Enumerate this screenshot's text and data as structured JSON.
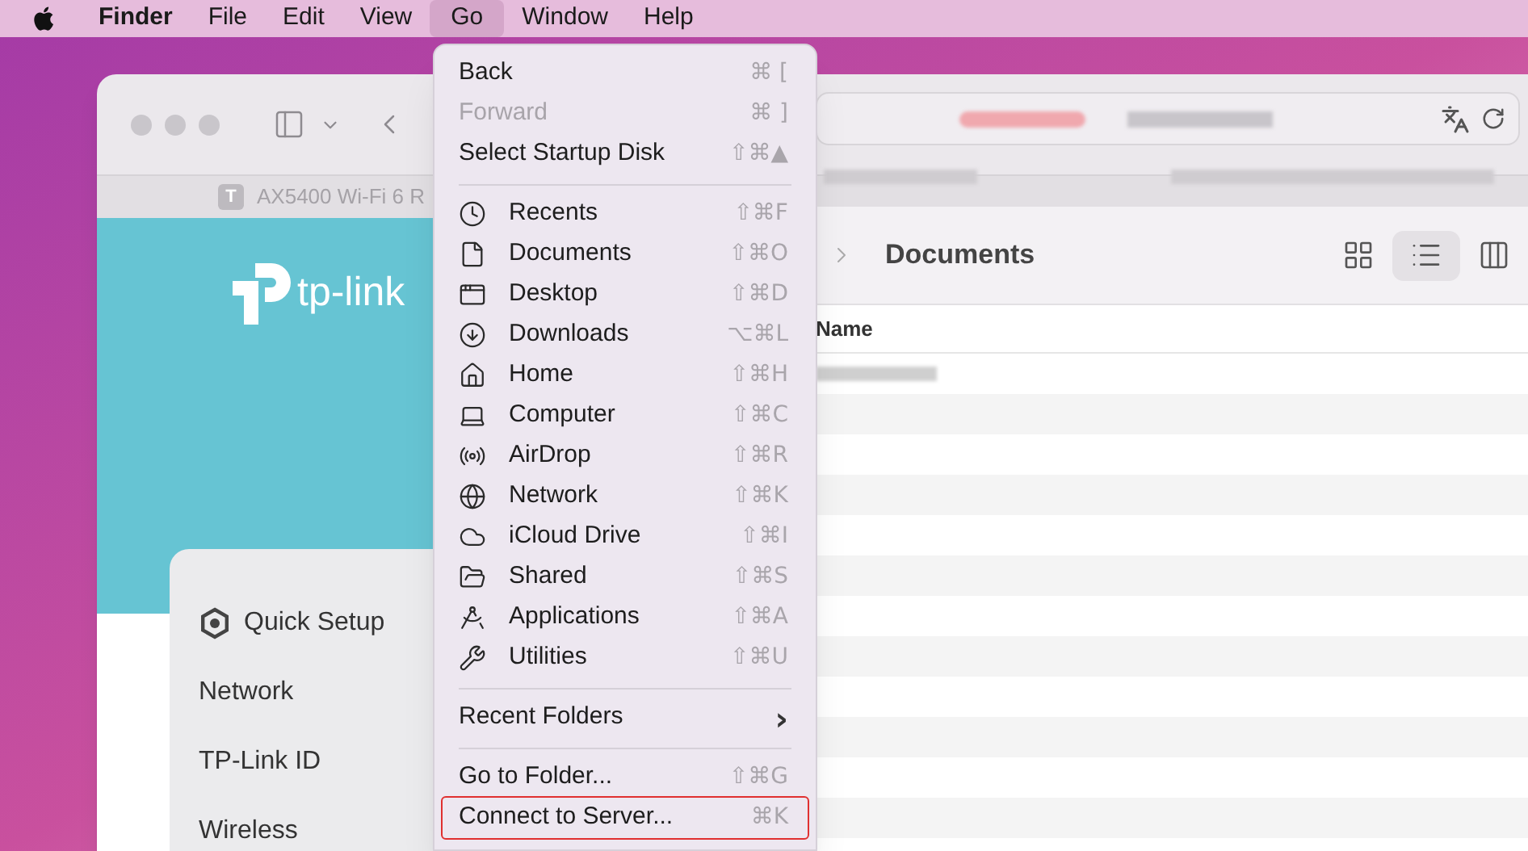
{
  "menu_bar": {
    "items": [
      {
        "label": "Finder",
        "selected": false
      },
      {
        "label": "File",
        "selected": false
      },
      {
        "label": "Edit",
        "selected": false
      },
      {
        "label": "View",
        "selected": false
      },
      {
        "label": "Go",
        "selected": true
      },
      {
        "label": "Window",
        "selected": false
      },
      {
        "label": "Help",
        "selected": false
      }
    ]
  },
  "browser": {
    "tab": {
      "favicon_letter": "T",
      "title": "AX5400 Wi-Fi 6 R"
    },
    "page": {
      "logo_text": "tp-link",
      "sidebar": [
        {
          "label": "Quick Setup",
          "kind": "gear"
        },
        {
          "label": "Network",
          "kind": "plain"
        },
        {
          "label": "TP-Link ID",
          "kind": "plain"
        },
        {
          "label": "Wireless",
          "kind": "plain"
        }
      ]
    }
  },
  "finder": {
    "title": "Documents",
    "views": [
      {
        "kind": "icons",
        "selected": false
      },
      {
        "kind": "list",
        "selected": true
      },
      {
        "kind": "columns",
        "selected": false
      }
    ],
    "columns": [
      "Name"
    ]
  },
  "go_menu": {
    "items": [
      {
        "kind": "command",
        "label": "Back",
        "shortcut": "⌘ [",
        "disabled": false,
        "outlined": false
      },
      {
        "kind": "command",
        "label": "Forward",
        "shortcut": "⌘ ]",
        "disabled": true,
        "outlined": false
      },
      {
        "kind": "command",
        "label": "Select Startup Disk",
        "shortcut": "⇧⌘▲",
        "disabled": false,
        "outlined": false
      },
      {
        "kind": "separator"
      },
      {
        "kind": "place",
        "label": "Recents",
        "shortcut": "⇧⌘F",
        "disabled": false,
        "outlined": false
      },
      {
        "kind": "place",
        "label": "Documents",
        "shortcut": "⇧⌘O",
        "disabled": false,
        "outlined": false
      },
      {
        "kind": "place",
        "label": "Desktop",
        "shortcut": "⇧⌘D",
        "disabled": false,
        "outlined": false
      },
      {
        "kind": "place",
        "label": "Downloads",
        "shortcut": "⌥⌘L",
        "disabled": false,
        "outlined": false
      },
      {
        "kind": "place",
        "label": "Home",
        "shortcut": "⇧⌘H",
        "disabled": false,
        "outlined": false
      },
      {
        "kind": "place",
        "label": "Computer",
        "shortcut": "⇧⌘C",
        "disabled": false,
        "outlined": false
      },
      {
        "kind": "place",
        "label": "AirDrop",
        "shortcut": "⇧⌘R",
        "disabled": false,
        "outlined": false
      },
      {
        "kind": "place",
        "label": "Network",
        "shortcut": "⇧⌘K",
        "disabled": false,
        "outlined": false
      },
      {
        "kind": "place",
        "label": "iCloud Drive",
        "shortcut": "⇧⌘I",
        "disabled": false,
        "outlined": false
      },
      {
        "kind": "place",
        "label": "Shared",
        "shortcut": "⇧⌘S",
        "disabled": false,
        "outlined": false
      },
      {
        "kind": "place",
        "label": "Applications",
        "shortcut": "⇧⌘A",
        "disabled": false,
        "outlined": false
      },
      {
        "kind": "place",
        "label": "Utilities",
        "shortcut": "⇧⌘U",
        "disabled": false,
        "outlined": false
      },
      {
        "kind": "separator"
      },
      {
        "kind": "submenu",
        "label": "Recent Folders",
        "shortcut": "›",
        "disabled": false,
        "outlined": false
      },
      {
        "kind": "separator"
      },
      {
        "kind": "command",
        "label": "Go to Folder...",
        "shortcut": "⇧⌘G",
        "disabled": false,
        "outlined": false
      },
      {
        "kind": "command",
        "label": "Connect to Server...",
        "shortcut": "⌘K",
        "disabled": false,
        "outlined": true
      }
    ]
  }
}
